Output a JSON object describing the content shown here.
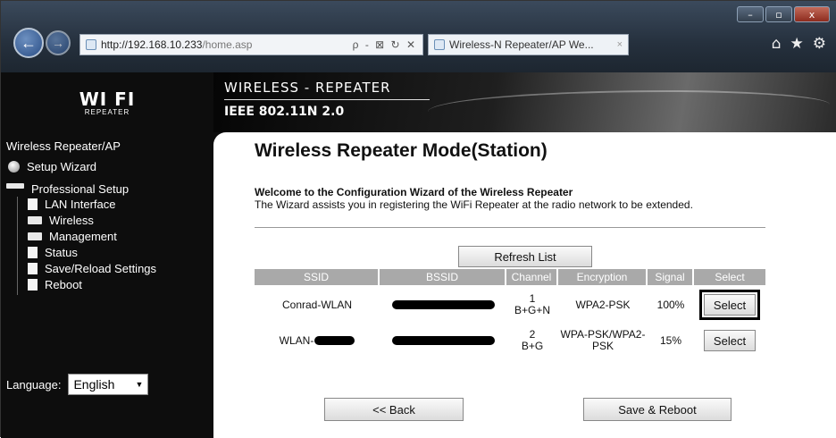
{
  "browser": {
    "url_host": "http://192.168.10.233",
    "url_path": "/home.asp",
    "address_tools": "ρ - ⊠ ↻ ✕",
    "tab_label": "Wireless-N Repeater/AP We...",
    "tab_close": "×",
    "window_controls": [
      "–",
      "▫",
      "x"
    ],
    "right_tools": [
      "⌂",
      "★",
      "⚙"
    ]
  },
  "logo": {
    "main": "WI FI",
    "sub": "REPEATER"
  },
  "header": {
    "title": "WIRELESS - REPEATER",
    "subtitle": "IEEE 802.11N 2.0"
  },
  "sidebar": {
    "title": "Wireless Repeater/AP",
    "setup_wizard": "Setup Wizard",
    "professional_setup": "Professional Setup",
    "items": [
      "LAN Interface",
      "Wireless",
      "Management",
      "Status",
      "Save/Reload Settings",
      "Reboot"
    ],
    "language_label": "Language:",
    "language_value": "English",
    "language_arrow": "▼"
  },
  "main": {
    "title": "Wireless Repeater Mode(Station)",
    "welcome_bold": "Welcome to the Configuration Wizard of the Wireless Repeater",
    "welcome_text": "The Wizard assists you in registering the WiFi Repeater at the radio network to be extended.",
    "refresh_label": "Refresh List",
    "back_label": "<< Back",
    "save_label": "Save & Reboot",
    "columns": [
      "SSID",
      "BSSID",
      "Channel",
      "Encryption",
      "Signal",
      "Select"
    ],
    "rows": [
      {
        "ssid": "Conrad-WLAN",
        "channel_num": "1",
        "channel_mode": "B+G+N",
        "encryption": "WPA2-PSK",
        "signal": "100%",
        "select": "Select"
      },
      {
        "ssid": "WLAN-",
        "channel_num": "2",
        "channel_mode": "B+G",
        "encryption": "WPA-PSK/WPA2-PSK",
        "signal": "15%",
        "select": "Select"
      }
    ]
  },
  "colors": {
    "sidebar_bg": "#0d0d0d",
    "table_header": "#a9a9a9",
    "accent": "#2a4e86"
  }
}
